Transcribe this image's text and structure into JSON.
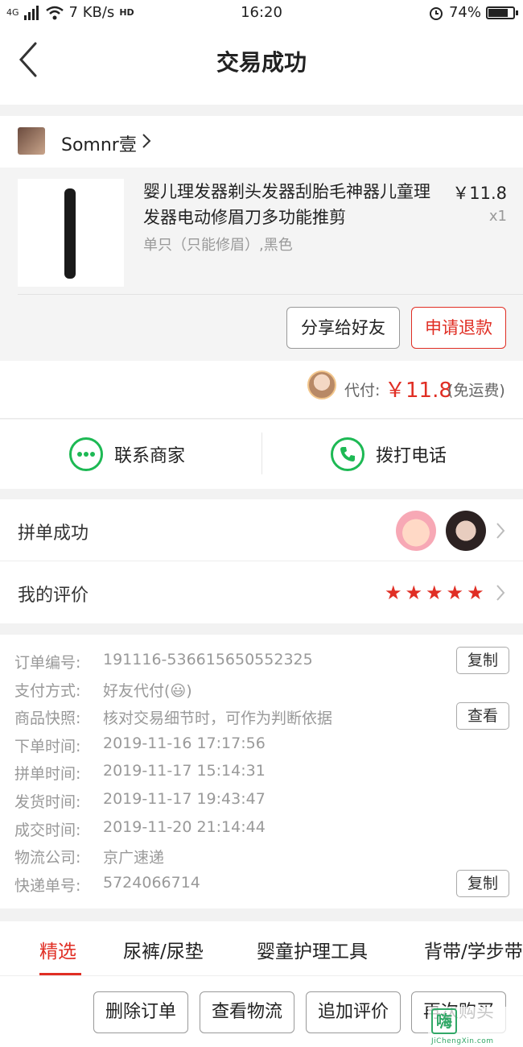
{
  "status_bar": {
    "network": "4G",
    "speed": "7 KB/s",
    "hd": "HD",
    "time": "16:20",
    "battery": "74%",
    "battery_level": 0.74
  },
  "navbar": {
    "title": "交易成功"
  },
  "seller": {
    "name": "Somnr壹"
  },
  "product": {
    "title": "婴儿理发器剃头发器刮胎毛神器儿童理发器电动修眉刀多功能推剪",
    "price": "￥11.8",
    "qty": "x1",
    "spec": "单只（只能修眉）,黑色",
    "share_label": "分享给好友",
    "refund_label": "申请退款"
  },
  "payment": {
    "label": "代付:",
    "amount": "￥11.8",
    "note": "(免运费)"
  },
  "contact": {
    "merchant_label": "联系商家",
    "phone_label": "拨打电话"
  },
  "group": {
    "group_label": "拼单成功",
    "review_label": "我的评价",
    "rating": 5,
    "stars": [
      "★",
      "★",
      "★",
      "★",
      "★"
    ]
  },
  "info": {
    "rows": [
      {
        "key": "订单编号:",
        "value": "191116-536615650552325"
      },
      {
        "key": "支付方式:",
        "value": "好友代付(😃)"
      },
      {
        "key": "商品快照:",
        "value": "核对交易细节时，可作为判断依据"
      },
      {
        "key": "下单时间:",
        "value": "2019-11-16 17:17:56"
      },
      {
        "key": "拼单时间:",
        "value": "2019-11-17 15:14:31"
      },
      {
        "key": "发货时间:",
        "value": "2019-11-17 19:43:47"
      },
      {
        "key": "成交时间:",
        "value": "2019-11-20 21:14:44"
      },
      {
        "key": "物流公司:",
        "value": "京广速递"
      },
      {
        "key": "快递单号:",
        "value": "5724066714"
      }
    ],
    "copy_label": "复制",
    "view_label": "查看"
  },
  "tabs": [
    "精选",
    "尿裤/尿垫",
    "婴童护理工具",
    "背带/学步带"
  ],
  "bottom_buttons": [
    "删除订单",
    "查看物流",
    "追加评价",
    "再次购买"
  ],
  "watermark": {
    "main": "嗨",
    "sub": "JiChengXin.com"
  },
  "colors": {
    "accent": "#e02e24",
    "green": "#1db954"
  }
}
